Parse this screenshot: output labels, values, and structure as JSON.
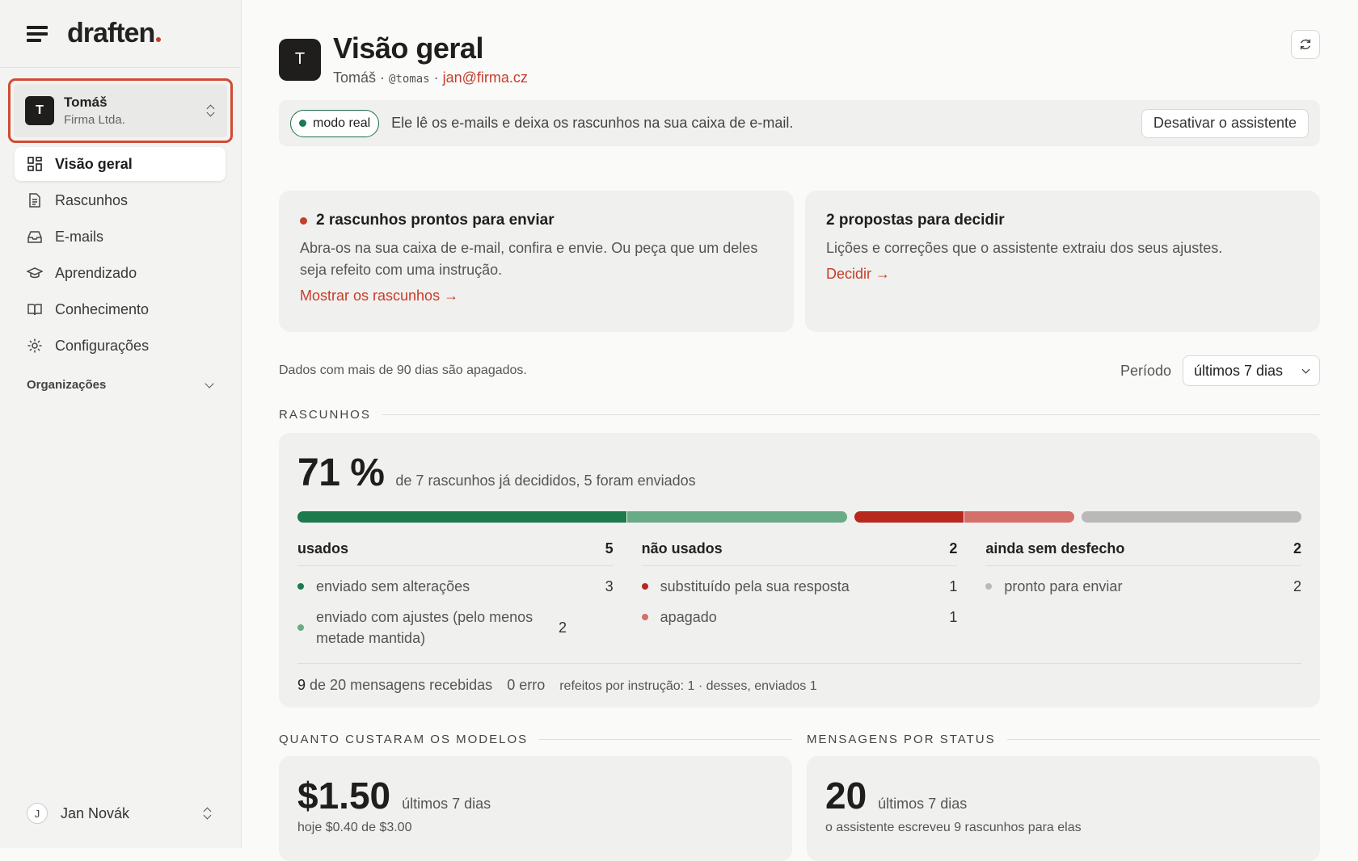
{
  "app": {
    "brand": "draften"
  },
  "workspace": {
    "avatar": "T",
    "name": "Tomáš",
    "org": "Firma Ltda."
  },
  "nav": [
    {
      "label": "Visão geral",
      "icon": "grid-icon",
      "active": true
    },
    {
      "label": "Rascunhos",
      "icon": "document-icon"
    },
    {
      "label": "E-mails",
      "icon": "inbox-icon"
    },
    {
      "label": "Aprendizado",
      "icon": "graduation-cap-icon"
    },
    {
      "label": "Conhecimento",
      "icon": "book-icon"
    },
    {
      "label": "Configurações",
      "icon": "gear-icon"
    }
  ],
  "orgs_label": "Organizações",
  "user": {
    "initial": "J",
    "name": "Jan Novák"
  },
  "header": {
    "avatar": "T",
    "title": "Visão geral",
    "name": "Tomáš",
    "handle": "@tomas",
    "email": "jan@firma.cz"
  },
  "banner": {
    "pill": "modo real",
    "message": "Ele lê os e-mails e deixa os rascunhos na sua caixa de e-mail.",
    "button": "Desativar o assistente"
  },
  "cards": {
    "drafts": {
      "title": "2 rascunhos prontos para enviar",
      "body": "Abra-os na sua caixa de e-mail, confira e envie. Ou peça que um deles seja refeito com uma instrução.",
      "link": "Mostrar os rascunhos →"
    },
    "proposals": {
      "title": "2 propostas para decidir",
      "body": "Lições e correções que o assistente extraiu dos seus ajustes.",
      "link": "Decidir →"
    }
  },
  "retention_note": "Dados com mais de 90 dias são apagados.",
  "period": {
    "label": "Período",
    "value": "últimos 7 dias"
  },
  "sections": {
    "drafts": "RASCUNHOS",
    "cost": "QUANTO CUSTARAM OS MODELOS",
    "messages": "MENSAGENS POR STATUS"
  },
  "drafts_stats": {
    "percent": "71 %",
    "percent_label": "de 7 rascunhos já decididos, 5 foram enviados",
    "bar": [
      {
        "value": 3,
        "color": "#1c7a4e"
      },
      {
        "value": 2,
        "color": "#6aab87"
      },
      {
        "value": 1,
        "color": "#b8281f"
      },
      {
        "value": 1,
        "color": "#d46f6a"
      },
      {
        "value": 2,
        "color": "#b9b9b7"
      }
    ],
    "groups": [
      {
        "title": "usados",
        "count": "5",
        "items": [
          {
            "label": "enviado sem alterações",
            "count": "3",
            "color": "#1c7a4e"
          },
          {
            "label": "enviado com ajustes (pelo menos metade mantida)",
            "count": "2",
            "color": "#6aab87"
          }
        ]
      },
      {
        "title": "não usados",
        "count": "2",
        "items": [
          {
            "label": "substituído pela sua resposta",
            "count": "1",
            "color": "#b8281f"
          },
          {
            "label": "apagado",
            "count": "1",
            "color": "#d46f6a"
          }
        ]
      },
      {
        "title": "ainda sem desfecho",
        "count": "2",
        "items": [
          {
            "label": "pronto para enviar",
            "count": "2",
            "color": "#b9b9b7"
          }
        ]
      }
    ],
    "footer": {
      "received_num": "9",
      "received_text": "de 20 mensagens recebidas",
      "errors": "0 erro",
      "redone": "refeitos por instrução: 1 · desses, enviados 1"
    }
  },
  "cost": {
    "value": "$1.50",
    "period": "últimos 7 dias",
    "sub": "hoje $0.40 de $3.00"
  },
  "messages": {
    "value": "20",
    "period": "últimos 7 dias",
    "sub": "o assistente escreveu 9 rascunhos para elas"
  }
}
